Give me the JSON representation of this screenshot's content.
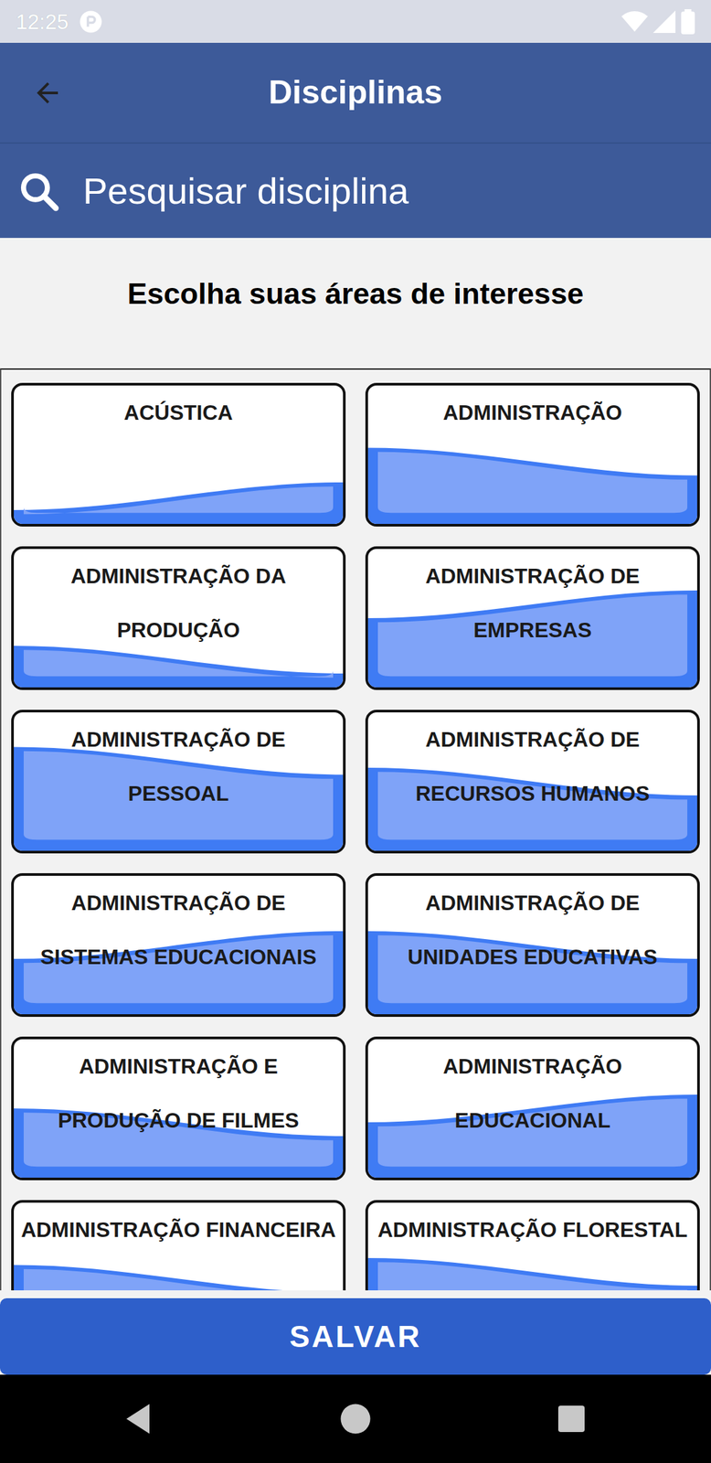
{
  "status_bar": {
    "time": "12:25"
  },
  "app_bar": {
    "title": "Disciplinas"
  },
  "search": {
    "placeholder": "Pesquisar disciplina"
  },
  "heading": "Escolha suas áreas de interesse",
  "cards": [
    {
      "label": "ACÚSTICA",
      "level": 0.2
    },
    {
      "label": "ADMINISTRAÇÃO",
      "level": 0.45
    },
    {
      "label": "ADMINISTRAÇÃO DA PRODUÇÃO",
      "level": 0.2
    },
    {
      "label": "ADMINISTRAÇÃO DE EMPRESAS",
      "level": 0.6
    },
    {
      "label": "ADMINISTRAÇÃO DE PESSOAL",
      "level": 0.65
    },
    {
      "label": "ADMINISTRAÇÃO DE RECURSOS HUMANOS",
      "level": 0.5
    },
    {
      "label": "ADMINISTRAÇÃO DE SISTEMAS EDUCACIONAIS",
      "level": 0.5
    },
    {
      "label": "ADMINISTRAÇÃO DE UNIDADES EDUCATIVAS",
      "level": 0.5
    },
    {
      "label": "ADMINISTRAÇÃO E PRODUÇÃO DE FILMES",
      "level": 0.4
    },
    {
      "label": "ADMINISTRAÇÃO EDUCACIONAL",
      "level": 0.5
    },
    {
      "label": "ADMINISTRAÇÃO FINANCEIRA",
      "level": 0.45
    },
    {
      "label": "ADMINISTRAÇÃO FLORESTAL",
      "level": 0.5
    }
  ],
  "save_button": "SALVAR"
}
